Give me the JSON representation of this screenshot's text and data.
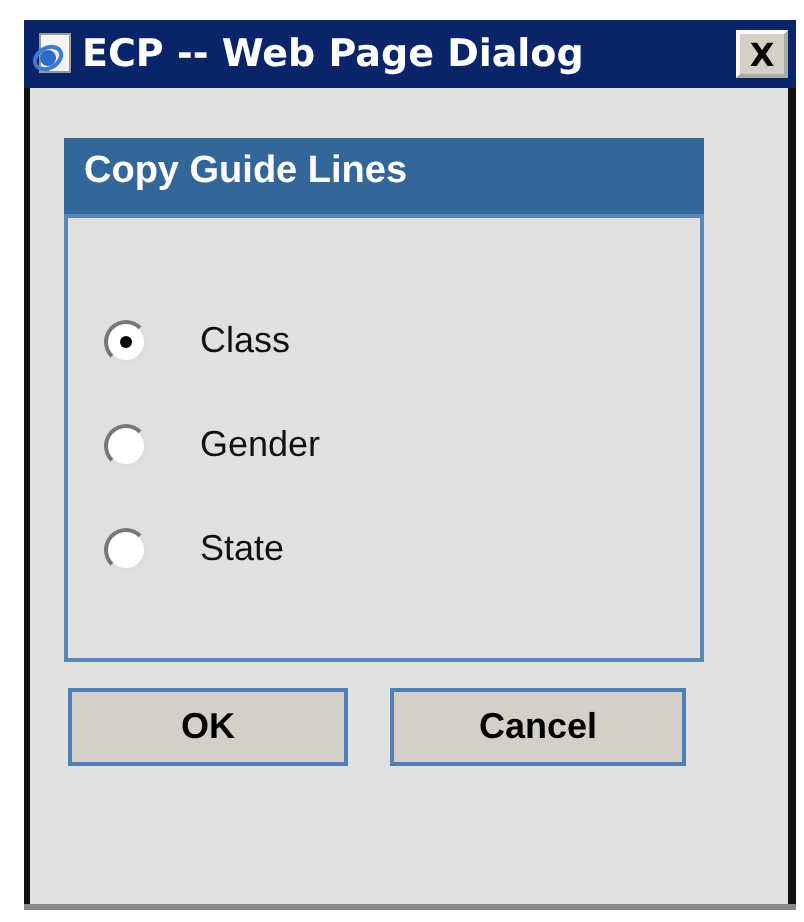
{
  "window": {
    "title": "ECP -- Web Page Dialog",
    "close": "X"
  },
  "panel": {
    "title": "Copy Guide Lines"
  },
  "options": [
    {
      "label": "Class",
      "selected": true
    },
    {
      "label": "Gender",
      "selected": false
    },
    {
      "label": "State",
      "selected": false
    }
  ],
  "buttons": [
    "OK",
    "Cancel"
  ]
}
